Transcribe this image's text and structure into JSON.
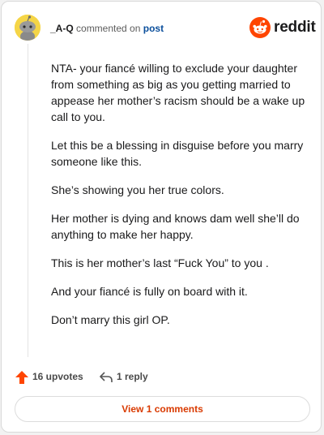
{
  "comment": {
    "username": "_A-Q",
    "action_text": "commented on",
    "post_link": "post",
    "paragraphs": [
      "NTA- your fiancé willing to exclude your daughter from something as big as you getting married to appease her mother’s racism should be a wake up call to you.",
      "Let this be a blessing in disguise before you marry someone like this.",
      "She’s showing you her true colors.",
      "Her mother is dying and knows dam well she’ll do anything to make her happy.",
      "This is her mother’s last “Fuck You” to you .",
      "And your fiancé is fully on board with it.",
      "Don’t marry this girl OP."
    ]
  },
  "brand": {
    "name": "reddit",
    "icon": "reddit-snoo-icon",
    "color": "#ff4500"
  },
  "actions": {
    "upvotes": "16 upvotes",
    "upvote_icon": "upvote-arrow-icon",
    "replies": "1 reply",
    "reply_icon": "reply-arrow-icon",
    "view_comments": "View 1 comments"
  },
  "colors": {
    "upvote": "#ff4500",
    "view_button_text": "#d93a00",
    "post_link": "#0b4f9c"
  }
}
